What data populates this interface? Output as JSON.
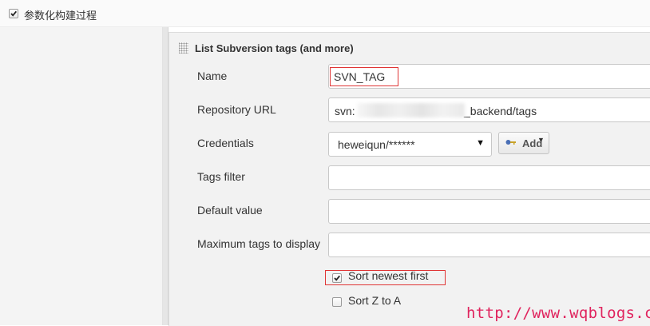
{
  "top_option": {
    "label": "参数化构建过程",
    "checked": true
  },
  "section": {
    "title": "List Subversion tags (and more)",
    "fields": {
      "name": {
        "label": "Name",
        "value": "SVN_TAG"
      },
      "repo_url": {
        "label": "Repository URL",
        "value_prefix": "svn:",
        "value_suffix": "_backend/tags"
      },
      "credentials": {
        "label": "Credentials",
        "selected": "heweiqun/******",
        "add_label": "Add"
      },
      "tags_filter": {
        "label": "Tags filter",
        "value": ""
      },
      "default_value": {
        "label": "Default value",
        "value": ""
      },
      "max_tags": {
        "label": "Maximum tags to display",
        "value": ""
      }
    },
    "checkboxes": {
      "sort_newest": {
        "label": "Sort newest first",
        "checked": true
      },
      "sort_z_to_a": {
        "label": "Sort Z to A",
        "checked": false
      }
    }
  },
  "watermark": "http://www.wqblogs.com",
  "colors": {
    "highlight": "#e03535",
    "watermark": "#e0245e",
    "key_icon": "#4a6fb5"
  }
}
